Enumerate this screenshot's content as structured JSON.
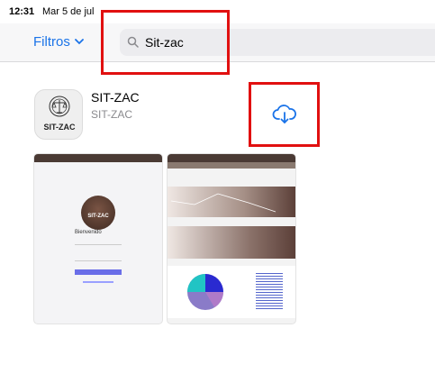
{
  "status_bar": {
    "time": "12:31",
    "date": "Mar 5 de jul"
  },
  "nav": {
    "filters_label": "Filtros"
  },
  "search": {
    "query": "Sit-zac"
  },
  "app": {
    "icon_text": "SIT-ZAC",
    "name": "SIT-ZAC",
    "developer": "SIT-ZAC"
  },
  "screenshots": {
    "login": {
      "logo_text": "SIT-ZAC",
      "welcome": "Bienvenido"
    }
  },
  "colors": {
    "accent": "#1a73e8",
    "highlight": "#e11010",
    "brand_brown": "#6b4a3f"
  }
}
